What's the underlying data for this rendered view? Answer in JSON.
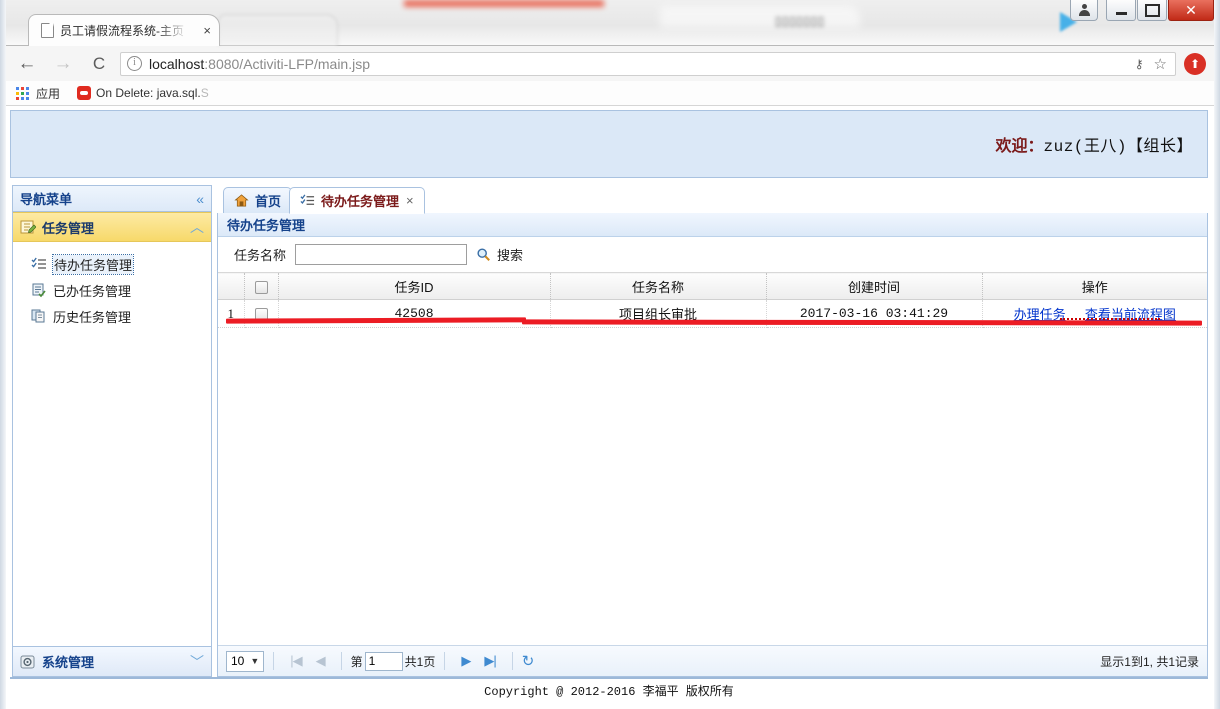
{
  "browser": {
    "tab_title": "员工请假流程系统-主页",
    "tab_close": "×",
    "back_icon": "←",
    "forward_icon": "→",
    "reload_icon": "C",
    "url_prefix": "localhost",
    "url_rest": ":8080/Activiti-LFP/main.jsp",
    "key_icon": "⚷",
    "star_icon": "☆",
    "update_icon": "⬆",
    "minimize_icon": "minimize-icon",
    "maximize_icon": "maximize-icon",
    "close_icon": "✕",
    "user_icon": "user-icon"
  },
  "bookmarks": {
    "apps_label": "应用",
    "item_label": "On Delete: java.sql.",
    "item_label_faded": "S"
  },
  "banner": {
    "welcome_label": "欢迎：",
    "welcome_user": "zuz(王八)【组长】"
  },
  "sidebar": {
    "header_title": "导航菜单",
    "collapse_icon": "«",
    "group": {
      "title": "任务管理",
      "chevron": "︿",
      "icon": "edit-note-icon"
    },
    "items": [
      {
        "label": "待办任务管理",
        "icon": "checklist-icon",
        "selected": true
      },
      {
        "label": "已办任务管理",
        "icon": "document-check-icon",
        "selected": false
      },
      {
        "label": "历史任务管理",
        "icon": "history-clipboard-icon",
        "selected": false
      }
    ],
    "footer": {
      "title": "系统管理",
      "chevron": "﹀",
      "icon": "gear-icon"
    }
  },
  "main": {
    "tabs": [
      {
        "label": "首页",
        "icon": "home-icon",
        "active": false,
        "closable": false
      },
      {
        "label": "待办任务管理",
        "icon": "checklist-icon",
        "active": true,
        "closable": true,
        "close_label": "×"
      }
    ],
    "panel_title": "待办任务管理",
    "search": {
      "label": "任务名称",
      "value": "",
      "placeholder": "",
      "button_label": "搜索",
      "button_icon": "search-icon"
    },
    "grid": {
      "columns": [
        "",
        "",
        "任务ID",
        "任务名称",
        "创建时间",
        "操作"
      ],
      "rows": [
        {
          "index": "1",
          "task_id": "42508",
          "task_name": "项目组长审批",
          "create_time": "2017-03-16 03:41:29",
          "actions": [
            "办理任务",
            "查看当前流程图"
          ]
        }
      ]
    },
    "pager": {
      "page_size": "10",
      "page_size_caret": "▼",
      "first_icon": "|◀",
      "prev_icon": "◀",
      "page_prefix": "第",
      "page_number": "1",
      "page_suffix": "共1页",
      "next_icon": "▶",
      "last_icon": "▶|",
      "refresh_icon": "↻",
      "info": "显示1到1, 共1记录"
    }
  },
  "footer": {
    "text": "Copyright @ 2012-2016 李福平 版权所有"
  }
}
